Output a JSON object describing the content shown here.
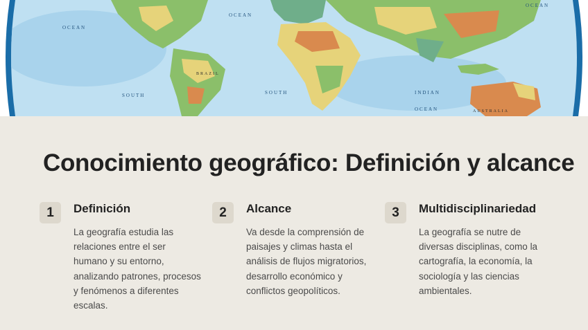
{
  "hero": {
    "map_labels": [
      "OCEAN",
      "OCEAN",
      "BRAZIL",
      "SOUTH",
      "SOUTH",
      "INDIAN",
      "OCEAN",
      "AUSTRALIA",
      "OCEAN"
    ],
    "colors": {
      "ocean": "#bfe0f2",
      "ocean_deep": "#8fc6e6",
      "land_green": "#8bbf6a",
      "land_yellow": "#e6d37a",
      "land_orange": "#d98a4e",
      "frame": "#1a6da8"
    }
  },
  "section": {
    "title": "Conocimiento geográfico: Definición y alcance"
  },
  "cards": [
    {
      "number": "1",
      "title": "Definición",
      "body": "La geografía estudia las relaciones entre el ser humano y su entorno, analizando patrones, procesos y fenómenos a diferentes escalas."
    },
    {
      "number": "2",
      "title": "Alcance",
      "body": "Va desde la comprensión de paisajes y climas hasta el análisis de flujos migratorios, desarrollo económico y conflictos geopolíticos."
    },
    {
      "number": "3",
      "title": "Multidisciplinariedad",
      "body": "La geografía se nutre de diversas disciplinas, como la cartografía, la economía, la sociología y las ciencias ambientales."
    }
  ]
}
